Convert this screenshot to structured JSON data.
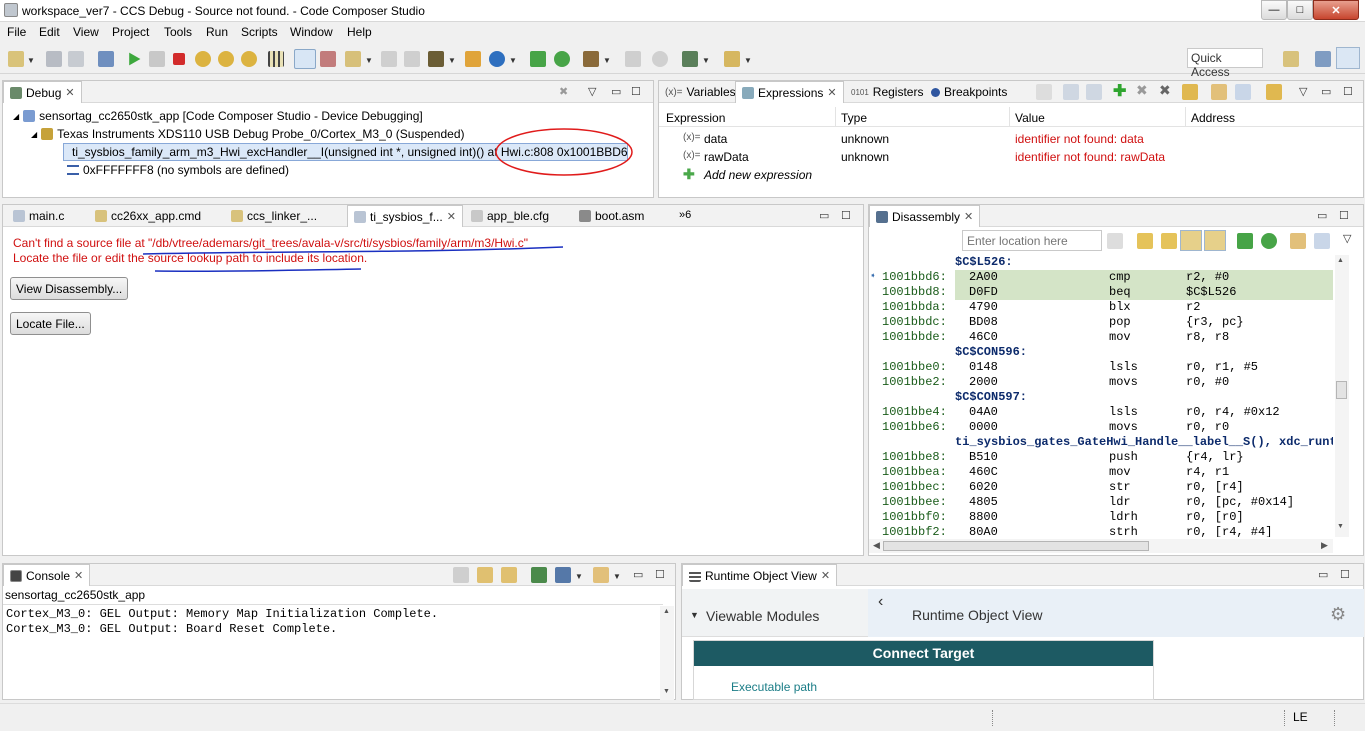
{
  "window": {
    "title": "workspace_ver7 - CCS Debug - Source not found. - Code Composer Studio",
    "min": "—",
    "max": "□",
    "close": "✕"
  },
  "menu": [
    "File",
    "Edit",
    "View",
    "Project",
    "Tools",
    "Run",
    "Scripts",
    "Window",
    "Help"
  ],
  "quick_access": "Quick Access",
  "debug": {
    "tab": "Debug",
    "items": [
      "sensortag_cc2650stk_app [Code Composer Studio - Device Debugging]",
      "Texas Instruments XDS110 USB Debug Probe_0/Cortex_M3_0 (Suspended)",
      "ti_sysbios_family_arm_m3_Hwi_excHandler__I(unsigned int *, unsigned int)() at Hwi.c:808 0x1001BBD6",
      "0xFFFFFFF8  (no symbols are defined)"
    ]
  },
  "expressions": {
    "tabs": [
      "Variables",
      "Expressions",
      "Registers",
      "Breakpoints"
    ],
    "columns": [
      "Expression",
      "Type",
      "Value",
      "Address"
    ],
    "rows": [
      {
        "name": "data",
        "type": "unknown",
        "value": "identifier not found: data"
      },
      {
        "name": "rawData",
        "type": "unknown",
        "value": "identifier not found: rawData"
      }
    ],
    "add": "Add new expression"
  },
  "editor": {
    "tabs": [
      "main.c",
      "cc26xx_app.cmd",
      "ccs_linker_...",
      "ti_sysbios_f...",
      "app_ble.cfg",
      "boot.asm"
    ],
    "overflow": "»6",
    "error1": "Can't find a source file at \"/db/vtree/ademars/git_trees/avala-v/src/ti/sysbios/family/arm/m3/Hwi.c\"",
    "error2": "Locate the file or edit the source lookup path to include its location.",
    "btn_disasm": "View Disassembly...",
    "btn_locate": "Locate File..."
  },
  "disassembly": {
    "tab": "Disassembly",
    "location_placeholder": "Enter location here",
    "lines": [
      {
        "kind": "label",
        "text": "$C$L526:"
      },
      {
        "kind": "ins",
        "addr": "1001bbd6:",
        "hex": "2A00",
        "op": "cmp",
        "args": "r2, #0",
        "hl": true,
        "cur": true
      },
      {
        "kind": "ins",
        "addr": "1001bbd8:",
        "hex": "D0FD",
        "op": "beq",
        "args": "$C$L526",
        "hl": true
      },
      {
        "kind": "ins",
        "addr": "1001bbda:",
        "hex": "4790",
        "op": "blx",
        "args": "r2"
      },
      {
        "kind": "ins",
        "addr": "1001bbdc:",
        "hex": "BD08",
        "op": "pop",
        "args": "{r3, pc}"
      },
      {
        "kind": "ins",
        "addr": "1001bbde:",
        "hex": "46C0",
        "op": "mov",
        "args": "r8, r8"
      },
      {
        "kind": "label",
        "text": "$C$CON596:"
      },
      {
        "kind": "ins",
        "addr": "1001bbe0:",
        "hex": "0148",
        "op": "lsls",
        "args": "r0, r1, #5"
      },
      {
        "kind": "ins",
        "addr": "1001bbe2:",
        "hex": "2000",
        "op": "movs",
        "args": "r0, #0"
      },
      {
        "kind": "label",
        "text": "$C$CON597:"
      },
      {
        "kind": "ins",
        "addr": "1001bbe4:",
        "hex": "04A0",
        "op": "lsls",
        "args": "r0, r4, #0x12"
      },
      {
        "kind": "ins",
        "addr": "1001bbe6:",
        "hex": "0000",
        "op": "movs",
        "args": "r0, r0"
      },
      {
        "kind": "label",
        "text": "ti_sysbios_gates_GateHwi_Handle__label__S(), xdc_runti"
      },
      {
        "kind": "ins",
        "addr": "1001bbe8:",
        "hex": "B510",
        "op": "push",
        "args": "{r4, lr}"
      },
      {
        "kind": "ins",
        "addr": "1001bbea:",
        "hex": "460C",
        "op": "mov",
        "args": "r4, r1"
      },
      {
        "kind": "ins",
        "addr": "1001bbec:",
        "hex": "6020",
        "op": "str",
        "args": "r0, [r4]"
      },
      {
        "kind": "ins",
        "addr": "1001bbee:",
        "hex": "4805",
        "op": "ldr",
        "args": "r0, [pc, #0x14]"
      },
      {
        "kind": "ins",
        "addr": "1001bbf0:",
        "hex": "8800",
        "op": "ldrh",
        "args": "r0, [r0]"
      },
      {
        "kind": "ins",
        "addr": "1001bbf2:",
        "hex": "80A0",
        "op": "strh",
        "args": "r0, [r4, #4]"
      }
    ]
  },
  "console": {
    "tab": "Console",
    "name": "sensortag_cc2650stk_app",
    "lines": [
      "Cortex_M3_0: GEL Output: Memory Map Initialization Complete.",
      "Cortex_M3_0: GEL Output: Board Reset Complete."
    ]
  },
  "rov": {
    "tab": "Runtime Object View",
    "modules": "Viewable Modules",
    "title": "Runtime Object View",
    "connect": "Connect Target",
    "exe": "Executable path"
  },
  "status": {
    "mode": "LE"
  },
  "colors": {
    "error": "#d01010",
    "highlight": "#d4e4c7",
    "disasm_addr": "#1a5c1a",
    "teal": "#1d5a63",
    "selection": "#dbe8f8"
  }
}
